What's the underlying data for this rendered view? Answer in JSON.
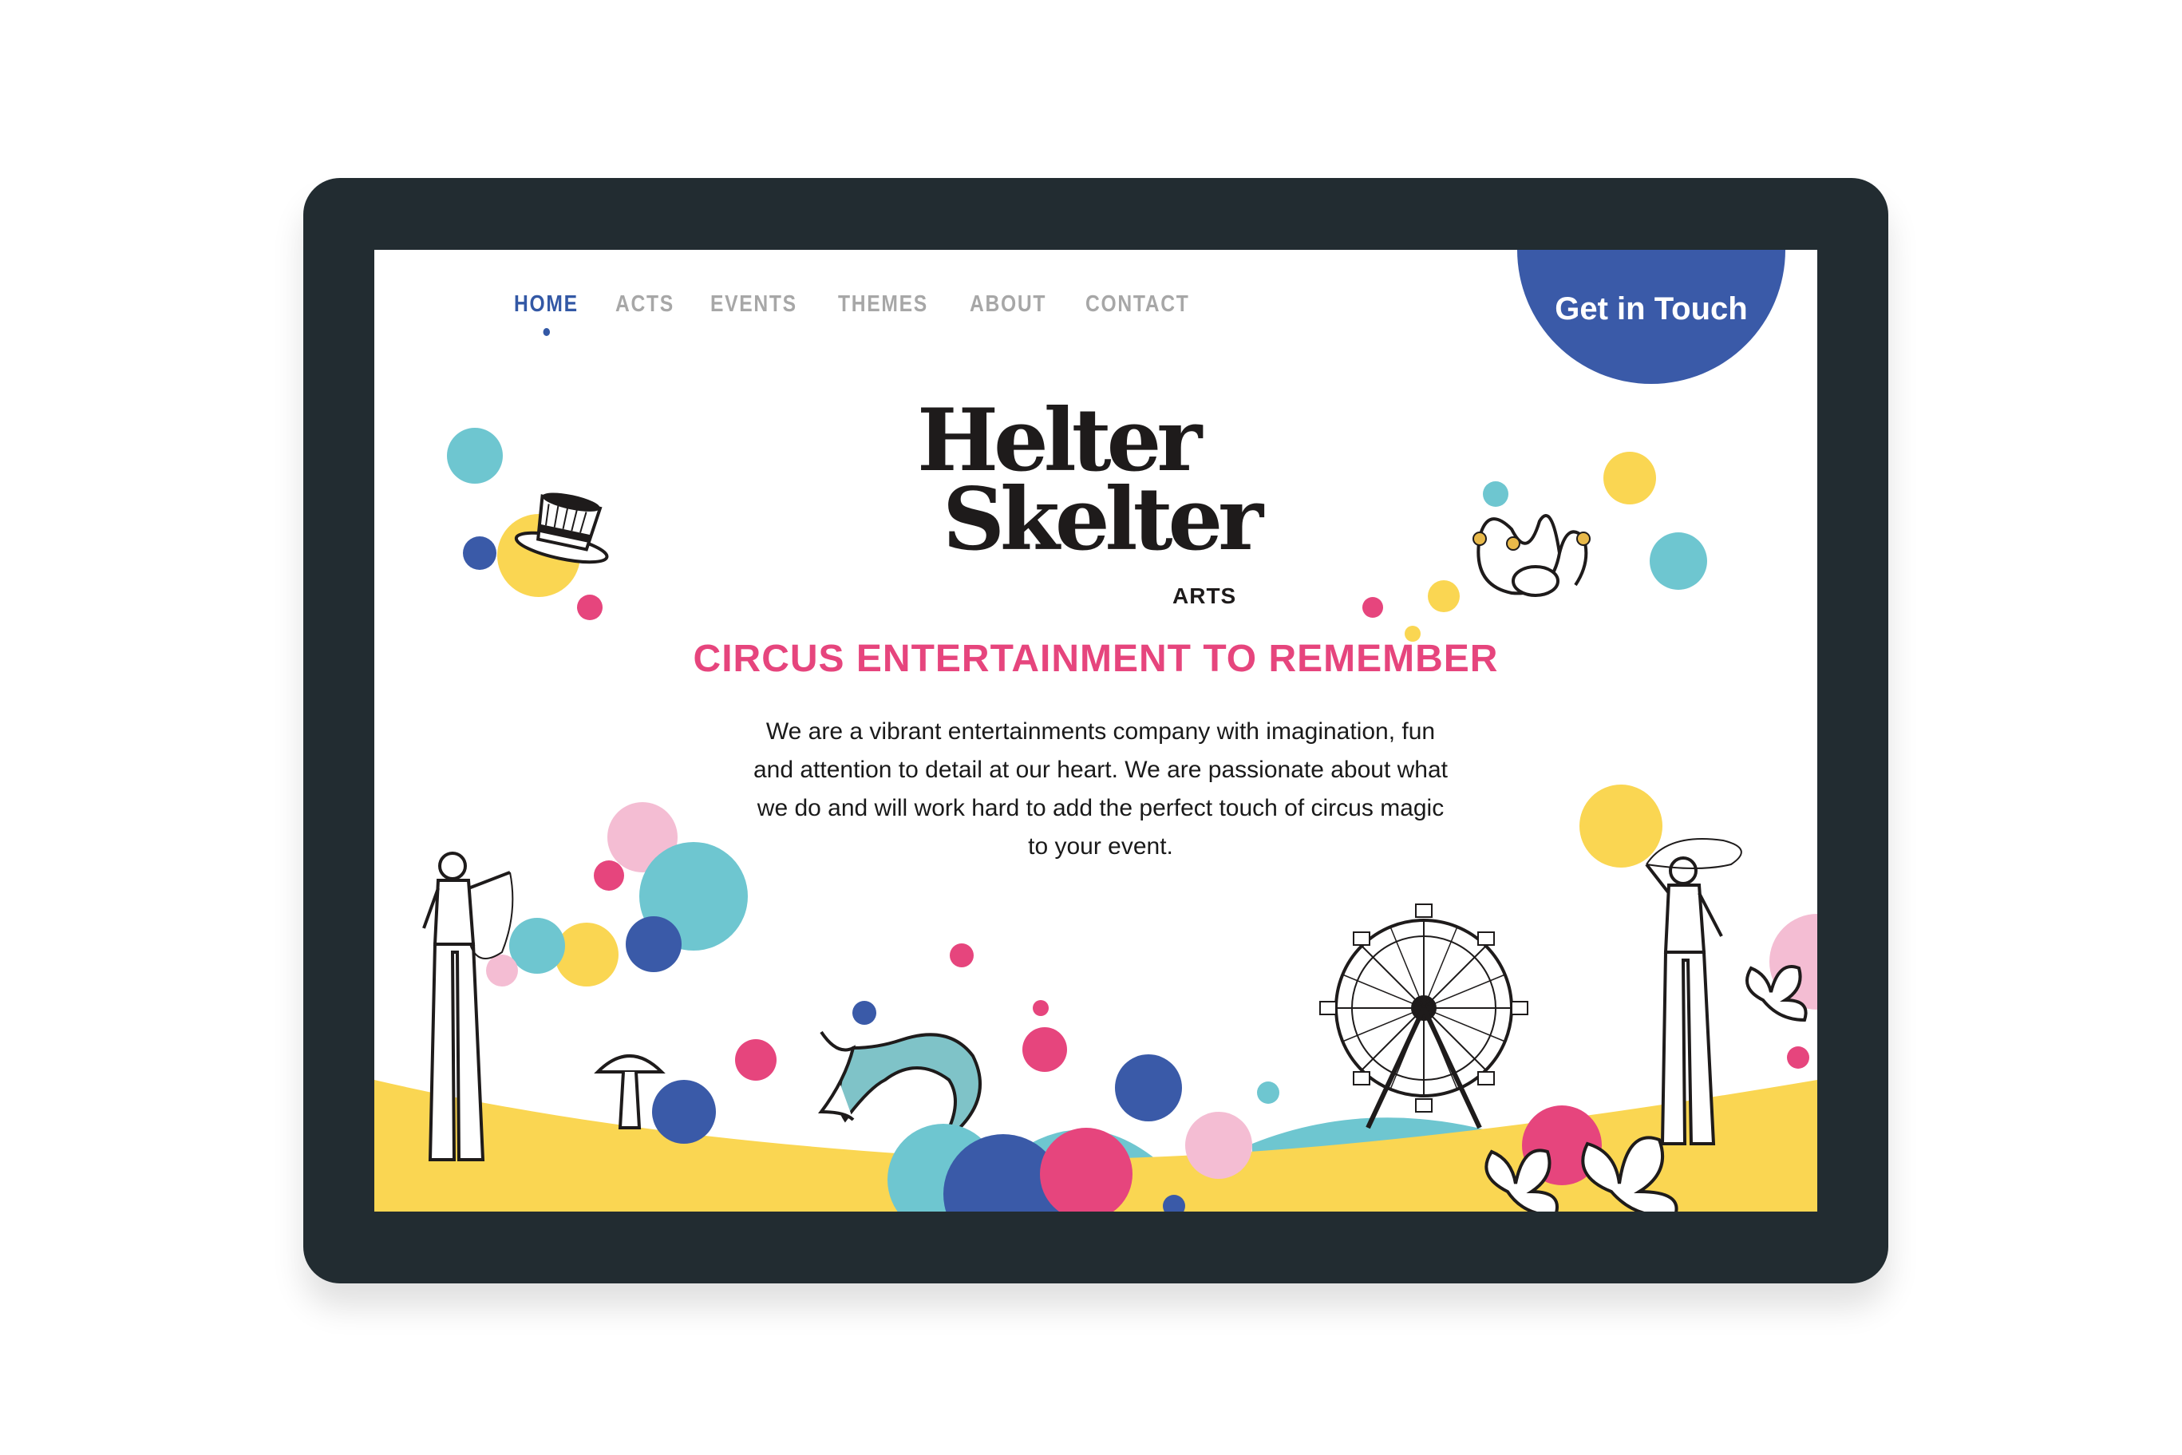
{
  "nav": {
    "items": [
      {
        "label": "HOME",
        "active": true
      },
      {
        "label": "ACTS",
        "active": false
      },
      {
        "label": "EVENTS",
        "active": false
      },
      {
        "label": "THEMES",
        "active": false
      },
      {
        "label": "ABOUT",
        "active": false
      },
      {
        "label": "CONTACT",
        "active": false
      }
    ]
  },
  "cta": {
    "label": "Get in Touch"
  },
  "logo": {
    "line1": "Helter",
    "line2": "Skelter",
    "sub": "ARTS"
  },
  "hero": {
    "tagline": "CIRCUS ENTERTAINMENT TO REMEMBER",
    "intro": "We are a vibrant entertainments company with imagination, fun and attention to detail at our heart. We are passionate about what we do and will work hard to add the perfect touch of circus magic to your event."
  },
  "colors": {
    "navy_frame": "#222c31",
    "blue": "#3a5aa8",
    "pink": "#e6457d",
    "teal": "#6ec6d0",
    "yellow": "#fad652",
    "light_pink": "#f4bdd3"
  },
  "illustrations": [
    "top-hat-icon",
    "jester-hat-icon",
    "stilt-walker-icon",
    "mushroom-icon",
    "mermaid-tail-icon",
    "ferris-wheel-icon",
    "lily-flower-icon"
  ]
}
